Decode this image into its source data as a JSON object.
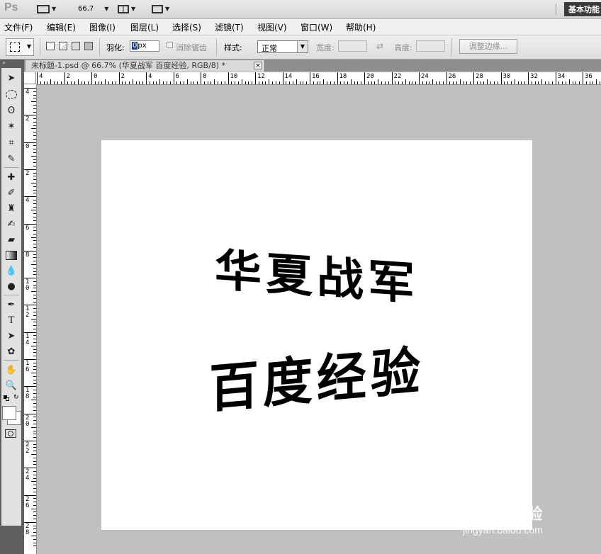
{
  "app": {
    "logo": "Ps",
    "zoom": "66.7",
    "workspace": "基本功能"
  },
  "menu": [
    "文件(F)",
    "编辑(E)",
    "图像(I)",
    "图层(L)",
    "选择(S)",
    "滤镜(T)",
    "视图(V)",
    "窗口(W)",
    "帮助(H)"
  ],
  "options": {
    "feather_label": "羽化:",
    "feather_value": "0",
    "feather_unit": "px",
    "antialias_label": "消除锯齿",
    "style_label": "样式:",
    "style_value": "正常",
    "width_label": "宽度:",
    "height_label": "高度:",
    "refine_button": "调整边缘..."
  },
  "document": {
    "tab_title": "未标题-1.psd @ 66.7% (华夏战军 百度经验, RGB/8) *",
    "close_symbol": "×"
  },
  "ruler": {
    "h_labels": [
      "4",
      "2",
      "0",
      "2",
      "4",
      "6",
      "8",
      "10",
      "12",
      "14",
      "16",
      "18",
      "20",
      "22",
      "24",
      "26",
      "28",
      "30",
      "32",
      "34",
      "36"
    ],
    "v_labels": [
      "4",
      "2",
      "0",
      "2",
      "4",
      "6",
      "8",
      "1 0",
      "1 2",
      "1 4",
      "1 6",
      "1 8",
      "2 0",
      "2 2",
      "2 4",
      "2 6",
      "2 8"
    ]
  },
  "canvas_text": {
    "line1": "华夏战军",
    "line2": "百度经验"
  },
  "watermark": {
    "brand": "Bai du 经验",
    "url": "jingyan.baidu.com"
  },
  "tools": [
    "move-icon",
    "marquee-ellipse-icon",
    "lasso-icon",
    "magic-wand-icon",
    "crop-icon",
    "eyedropper-icon",
    "healing-brush-icon",
    "brush-icon",
    "clone-stamp-icon",
    "history-brush-icon",
    "eraser-icon",
    "gradient-icon",
    "blur-icon",
    "dodge-icon",
    "pen-icon",
    "type-icon",
    "path-selection-icon",
    "shape-icon",
    "hand-icon",
    "zoom-icon"
  ]
}
